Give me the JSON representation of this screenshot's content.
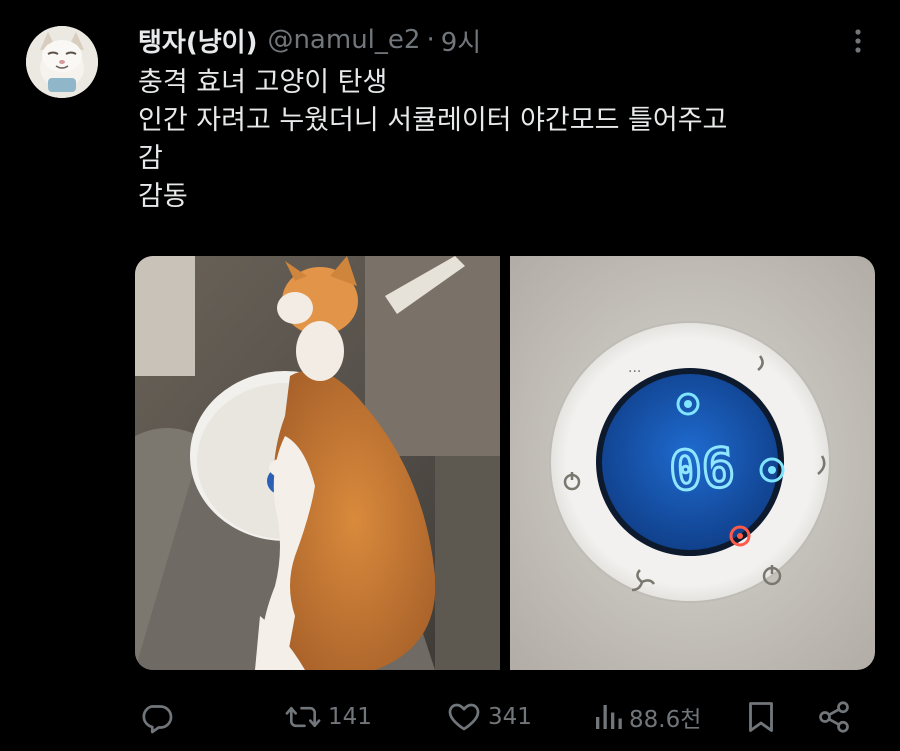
{
  "tweet": {
    "author": {
      "display_name": "탱자(냥이)",
      "handle": "@namul_e2",
      "separator": "·",
      "time": "9시"
    },
    "text_lines": [
      "충격 효녀 고양이 탄생",
      "인간 자려고 누웠더니 서큘레이터 야간모드 틀어주고",
      "감",
      "감동"
    ],
    "media": {
      "display_digits": "06"
    },
    "actions": {
      "reply": {
        "icon": "reply-icon",
        "count": ""
      },
      "retweet": {
        "icon": "retweet-icon",
        "count": "141"
      },
      "like": {
        "icon": "heart-icon",
        "count": "341"
      },
      "views": {
        "icon": "views-icon",
        "count": "88.6천"
      },
      "bookmark": {
        "icon": "bookmark-icon"
      },
      "share": {
        "icon": "share-icon"
      }
    }
  },
  "colors": {
    "background": "#000000",
    "primary_text": "#e7e9ea",
    "secondary_text": "#71767b",
    "display_blue": "#1a5fc0",
    "display_glow": "#6fd6ff"
  }
}
